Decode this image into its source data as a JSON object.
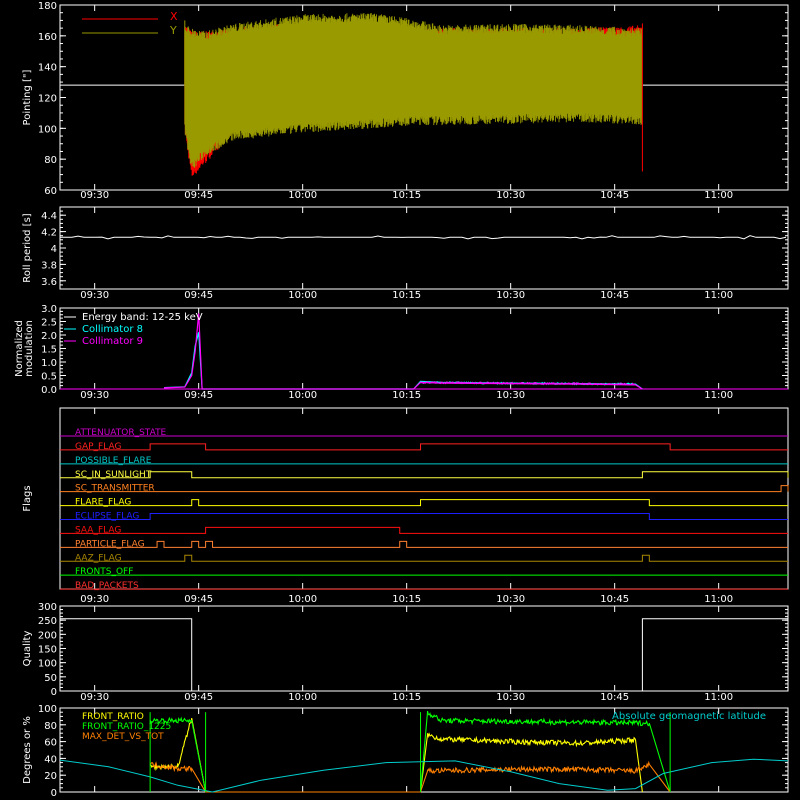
{
  "chart_data": [
    {
      "type": "line",
      "ylabel": "Pointing [\"]",
      "ylim": [
        60,
        180
      ],
      "yticks": [
        60,
        80,
        100,
        120,
        140,
        160,
        180
      ],
      "time_axis": {
        "range": [
          "09:25",
          "11:10"
        ],
        "tick_labels": [
          "09:30",
          "09:45",
          "10:00",
          "10:15",
          "10:30",
          "10:45",
          "11:00"
        ]
      },
      "baseline": 128,
      "envelope_time": [
        "09:43",
        "09:44",
        "09:46",
        "09:50",
        "10:00",
        "10:10",
        "10:16",
        "10:20",
        "10:30",
        "10:40",
        "10:45",
        "10:49"
      ],
      "series": [
        {
          "name": "X",
          "color": "#ff0000",
          "upper": [
            165,
            160,
            160,
            162,
            166,
            167,
            162,
            162,
            162,
            162,
            163,
            164
          ],
          "lower": [
            100,
            70,
            80,
            100,
            112,
            118,
            120,
            122,
            120,
            121,
            120,
            119
          ]
        },
        {
          "name": "Y",
          "color": "#999900",
          "upper": [
            165,
            162,
            160,
            165,
            171,
            172,
            168,
            164,
            165,
            164,
            163,
            162
          ],
          "lower": [
            100,
            75,
            85,
            95,
            100,
            103,
            105,
            105,
            106,
            107,
            106,
            105
          ]
        }
      ]
    },
    {
      "type": "line",
      "ylabel": "Roll period [s]",
      "ylim": [
        3.5,
        4.5
      ],
      "yticks": [
        3.6,
        3.8,
        4.0,
        4.2,
        4.4
      ],
      "time_axis": {
        "range": [
          "09:25",
          "11:10"
        ],
        "tick_labels": [
          "09:30",
          "09:45",
          "10:00",
          "10:15",
          "10:30",
          "10:45",
          "11:00"
        ]
      },
      "series": [
        {
          "name": "",
          "color": "#ffffff",
          "constant": 4.13
        }
      ]
    },
    {
      "type": "line",
      "ylabel": [
        "Normalized",
        "modulation"
      ],
      "ylim": [
        0,
        3.0
      ],
      "yticks": [
        0.0,
        0.5,
        1.0,
        1.5,
        2.0,
        2.5,
        3.0
      ],
      "ytick_labels": [
        "0.0",
        "0.5",
        "1.0",
        "1.5",
        "2.0",
        "2.5",
        "3.0"
      ],
      "time_axis": {
        "range": [
          "09:25",
          "11:10"
        ],
        "tick_labels": [
          "09:30",
          "09:45",
          "10:00",
          "10:15",
          "10:30",
          "10:45",
          "11:00"
        ]
      },
      "legend_title": "Energy band: 12-25 keV",
      "series": [
        {
          "name": "Collimator 8",
          "color": "#00ffff",
          "x": [
            "09:40",
            "09:43",
            "09:44",
            "09:44.5",
            "09:45",
            "09:45.5",
            "10:16",
            "10:17",
            "10:20",
            "10:30",
            "10:40",
            "10:48",
            "10:49"
          ],
          "y": [
            0.05,
            0.08,
            0.6,
            1.6,
            2.1,
            0.0,
            0.0,
            0.28,
            0.25,
            0.22,
            0.2,
            0.18,
            0.0
          ]
        },
        {
          "name": "Collimator 9",
          "color": "#ff00ff",
          "x": [
            "09:40",
            "09:43",
            "09:44",
            "09:44.5",
            "09:45",
            "09:45.5",
            "10:16",
            "10:17",
            "10:20",
            "10:30",
            "10:40",
            "10:48",
            "10:49"
          ],
          "y": [
            0.04,
            0.07,
            0.5,
            1.4,
            2.8,
            0.0,
            0.0,
            0.25,
            0.22,
            0.2,
            0.18,
            0.15,
            0.0
          ]
        }
      ]
    },
    {
      "type": "line",
      "ylabel": "Flags",
      "time_axis": {
        "range": [
          "09:25",
          "11:10"
        ],
        "tick_labels": [
          "09:30",
          "09:45",
          "10:00",
          "10:15",
          "10:30",
          "10:45",
          "11:00"
        ]
      },
      "flags": [
        {
          "name": "ATTENUATOR_STATE",
          "color": "#cc00cc",
          "intervals": []
        },
        {
          "name": "GAP_FLAG",
          "color": "#ff2020",
          "intervals": [
            [
              "09:38",
              "09:46"
            ],
            [
              "10:17",
              "10:53"
            ]
          ]
        },
        {
          "name": "POSSIBLE_FLARE",
          "color": "#00c8c8",
          "intervals": []
        },
        {
          "name": "SC_IN_SUNLIGHT",
          "color": "#ffff40",
          "intervals": [
            [
              "09:38",
              "09:44"
            ],
            [
              "10:49",
              "11:10"
            ]
          ]
        },
        {
          "name": "SC_TRANSMITTER",
          "color": "#ff8020",
          "intervals": [
            [
              "11:09",
              "11:10"
            ]
          ]
        },
        {
          "name": "FLARE_FLAG",
          "color": "#ffff00",
          "intervals": [
            [
              "09:44",
              "09:45"
            ],
            [
              "10:17",
              "10:50"
            ]
          ]
        },
        {
          "name": "ECLIPSE_FLAG",
          "color": "#2020ff",
          "intervals": [
            [
              "09:38",
              "10:50"
            ]
          ]
        },
        {
          "name": "SAA_FLAG",
          "color": "#ff1010",
          "intervals": [
            [
              "09:46",
              "10:14"
            ]
          ]
        },
        {
          "name": "PARTICLE_FLAG",
          "color": "#ff8030",
          "intervals": [
            [
              "09:39",
              "09:40"
            ],
            [
              "09:44",
              "09:45"
            ],
            [
              "09:46",
              "09:47"
            ],
            [
              "10:14",
              "10:15"
            ]
          ]
        },
        {
          "name": "AAZ_FLAG",
          "color": "#aa8800",
          "intervals": [
            [
              "09:43",
              "09:44"
            ],
            [
              "10:49",
              "10:50"
            ]
          ]
        },
        {
          "name": "FRONTS_OFF",
          "color": "#00ff00",
          "intervals": []
        },
        {
          "name": "BAD_PACKETS",
          "color": "#ff3030",
          "intervals": []
        }
      ]
    },
    {
      "type": "line",
      "ylabel": "Quality",
      "ylim": [
        0,
        300
      ],
      "yticks": [
        0,
        50,
        100,
        150,
        200,
        250,
        300
      ],
      "time_axis": {
        "range": [
          "09:25",
          "11:10"
        ],
        "tick_labels": [
          "09:30",
          "09:45",
          "10:00",
          "10:15",
          "10:30",
          "10:45",
          "11:00"
        ]
      },
      "series": [
        {
          "name": "",
          "color": "#ffffff",
          "x": [
            "09:25",
            "09:44",
            "09:44",
            "10:49",
            "10:49",
            "11:10"
          ],
          "y": [
            255,
            255,
            0,
            0,
            255,
            255
          ]
        }
      ]
    },
    {
      "type": "line",
      "ylabel": "Degrees or %",
      "ylim": [
        0,
        100
      ],
      "yticks": [
        0,
        20,
        40,
        60,
        80,
        100
      ],
      "time_axis": {
        "range": [
          "09:25",
          "11:10"
        ],
        "tick_labels": [
          "09:30",
          "09:45",
          "10:00",
          "10:15",
          "10:30",
          "10:45",
          "11:00"
        ]
      },
      "series": [
        {
          "name": "FRONT_RATIO",
          "color": "#ffff00",
          "x": [
            "09:38",
            "09:42",
            "09:44",
            "09:46",
            "10:17",
            "10:18",
            "10:20",
            "10:30",
            "10:40",
            "10:48",
            "10:49"
          ],
          "y": [
            30,
            30,
            88,
            0,
            0,
            68,
            63,
            60,
            58,
            62,
            0
          ]
        },
        {
          "name": "FRONT_RATIO_1225",
          "color": "#00ff00",
          "x": [
            "09:38",
            "09:42",
            "09:44",
            "09:46",
            "10:17",
            "10:18",
            "10:20",
            "10:30",
            "10:40",
            "10:50",
            "10:53"
          ],
          "y": [
            85,
            85,
            85,
            0,
            0,
            95,
            85,
            84,
            83,
            82,
            0
          ]
        },
        {
          "name": "MAX_DET_VS_TOT",
          "color": "#ff8000",
          "x": [
            "09:38",
            "09:42",
            "09:44",
            "09:46",
            "10:17",
            "10:18",
            "10:30",
            "10:40",
            "10:48",
            "10:50",
            "10:53"
          ],
          "y": [
            33,
            28,
            28,
            0,
            0,
            25,
            27,
            27,
            25,
            33,
            0
          ]
        },
        {
          "name": "Absolute geomagnetic latitude",
          "color": "#00cccc",
          "x": [
            "09:25",
            "09:32",
            "09:38",
            "09:42",
            "09:47",
            "09:54",
            "10:03",
            "10:12",
            "10:22",
            "10:30",
            "10:37",
            "10:44",
            "10:48",
            "10:52",
            "10:59",
            "11:05",
            "11:10"
          ],
          "y": [
            38,
            30,
            18,
            8,
            0,
            14,
            26,
            35,
            37,
            24,
            10,
            2,
            4,
            22,
            35,
            39,
            37
          ]
        }
      ]
    }
  ]
}
